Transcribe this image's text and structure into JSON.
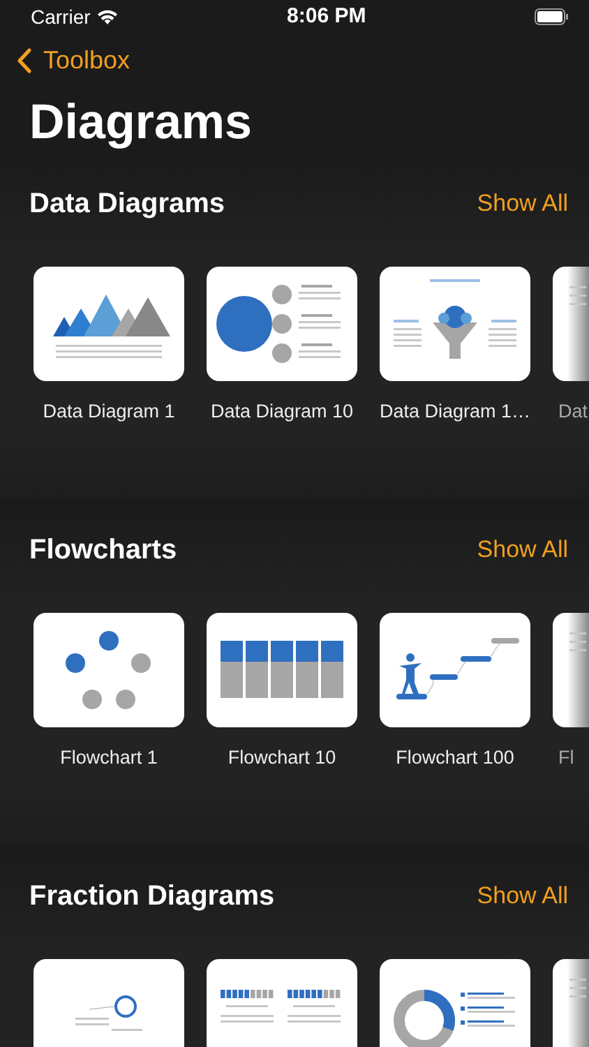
{
  "status_bar": {
    "carrier": "Carrier",
    "time": "8:06 PM"
  },
  "nav": {
    "back": "Toolbox",
    "title": "Diagrams"
  },
  "sections": [
    {
      "title": "Data Diagrams",
      "action": "Show All",
      "items": [
        {
          "label": "Data Diagram 1",
          "kind": "mountains"
        },
        {
          "label": "Data Diagram 10",
          "kind": "circles"
        },
        {
          "label": "Data Diagram 1…",
          "kind": "funnel"
        },
        {
          "label": "Dat",
          "kind": "partial"
        }
      ]
    },
    {
      "title": "Flowcharts",
      "action": "Show All",
      "items": [
        {
          "label": "Flowchart 1",
          "kind": "cycle"
        },
        {
          "label": "Flowchart 10",
          "kind": "columns"
        },
        {
          "label": "Flowchart 100",
          "kind": "steps"
        },
        {
          "label": "Fl",
          "kind": "partial"
        }
      ]
    },
    {
      "title": "Fraction Diagrams",
      "action": "Show All",
      "items": [
        {
          "kind": "rings"
        },
        {
          "kind": "bars"
        },
        {
          "kind": "donut"
        },
        {
          "kind": "partial"
        }
      ]
    }
  ]
}
